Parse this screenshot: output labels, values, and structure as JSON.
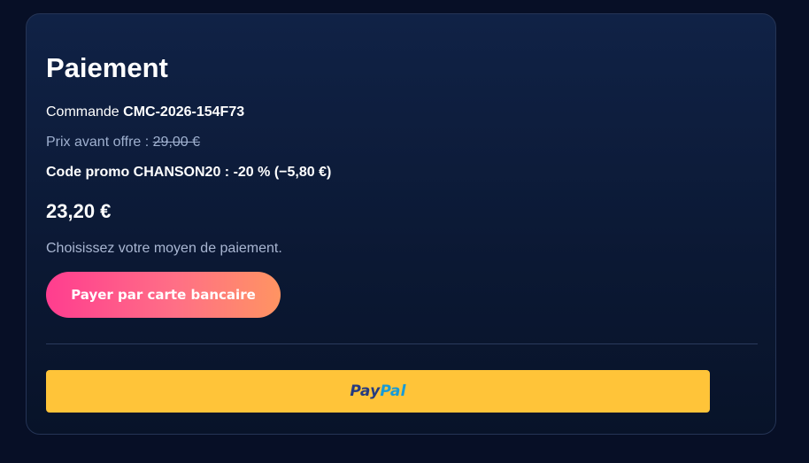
{
  "payment": {
    "title": "Paiement",
    "order_prefix": "Commande ",
    "order_id": "CMC-2026-154F73",
    "old_price_label": "Prix avant offre : ",
    "old_price": "29,00 €",
    "promo_text": "Code promo CHANSON20 : -20 % (−5,80 €)",
    "total": "23,20 €",
    "instructions": "Choisissez votre moyen de paiement.",
    "card_button_label": "Payer par carte bancaire",
    "paypal_logo_part1": "Pay",
    "paypal_logo_part2": "Pal"
  },
  "colors": {
    "background": "#070f26",
    "card_gradient_start": "#ff3d8f",
    "card_gradient_end": "#ff9462",
    "paypal_yellow": "#ffc439",
    "paypal_dark_blue": "#253b80",
    "paypal_light_blue": "#179bd7"
  }
}
